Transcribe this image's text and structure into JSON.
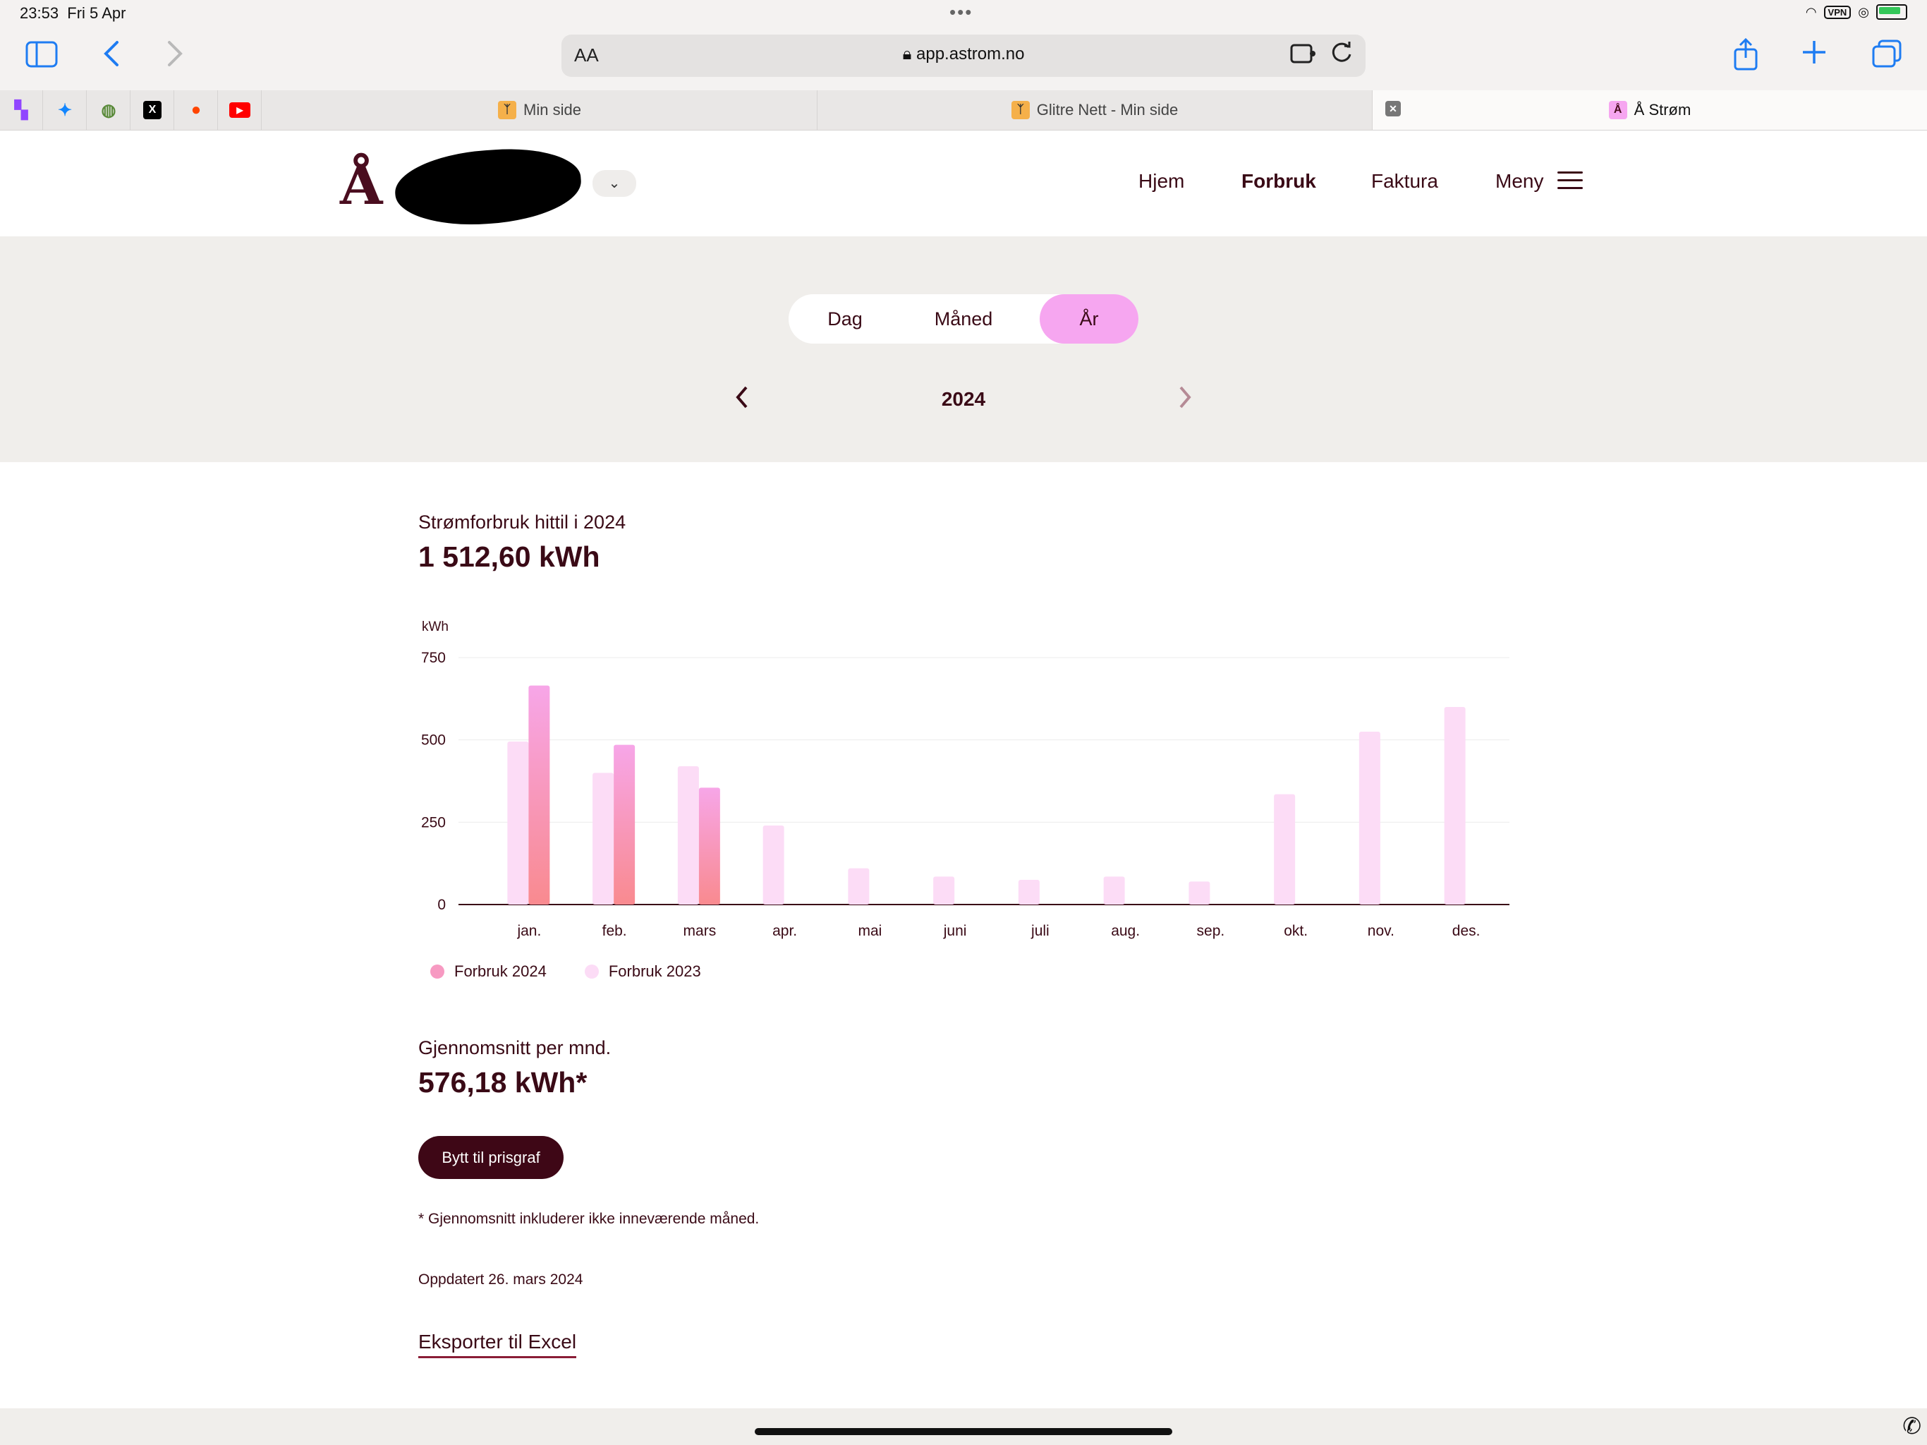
{
  "status_bar": {
    "time": "23:53",
    "date": "Fri 5 Apr",
    "vpn": "VPN"
  },
  "browser": {
    "text_size_label": "AA",
    "url": "app.astrom.no",
    "pinned_tabs": [
      "twitch-icon",
      "bluesky-icon",
      "mastodon-icon",
      "x-icon",
      "reddit-icon",
      "youtube-icon"
    ],
    "tabs": [
      {
        "title": "Min side",
        "active": false
      },
      {
        "title": "Glitre Nett - Min side",
        "active": false
      },
      {
        "title": "Å Strøm",
        "active": true
      }
    ]
  },
  "site": {
    "logo": "Å",
    "nav": {
      "home": "Hjem",
      "consumption": "Forbruk",
      "invoice": "Faktura",
      "menu": "Meny"
    },
    "period_tabs": {
      "day": "Dag",
      "month": "Måned",
      "year": "År",
      "selected": "År"
    },
    "year": "2024"
  },
  "summary": {
    "total_label": "Strømforbruk hittil i 2024",
    "total_value": "1 512,60 kWh",
    "avg_label": "Gjennomsnitt per mnd.",
    "avg_value": "576,18 kWh*",
    "toggle_button": "Bytt til prisgraf",
    "footnote": "* Gjennomsnitt inkluderer ikke inneværende måned.",
    "updated": "Oppdatert 26. mars 2024",
    "export_link": "Eksporter til Excel"
  },
  "colors": {
    "brand_dark": "#3e0716",
    "accent_pink": "#f6a6f0",
    "series_2024_top": "#f7a6e8",
    "series_2024_bottom": "#f98a8f",
    "series_2023": "#fcdcf6",
    "band_bg": "#f0eeeb"
  },
  "chart_data": {
    "type": "bar",
    "ylabel": "kWh",
    "ylim": [
      0,
      750
    ],
    "yticks": [
      "0",
      "250",
      "500",
      "750"
    ],
    "categories": [
      "jan.",
      "feb.",
      "mars",
      "apr.",
      "mai",
      "juni",
      "juli",
      "aug.",
      "sep.",
      "okt.",
      "nov.",
      "des."
    ],
    "series": [
      {
        "name": "Forbruk 2024",
        "values": [
          665,
          485,
          355,
          null,
          null,
          null,
          null,
          null,
          null,
          null,
          null,
          null
        ]
      },
      {
        "name": "Forbruk 2023",
        "values": [
          495,
          400,
          420,
          240,
          110,
          85,
          75,
          85,
          70,
          335,
          525,
          600
        ]
      }
    ],
    "grid": true,
    "legend_position": "bottom-left"
  }
}
